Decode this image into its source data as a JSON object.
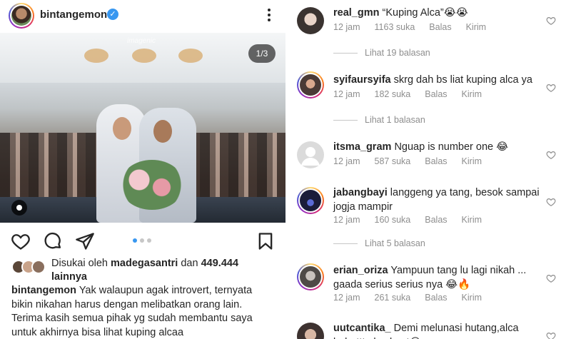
{
  "post": {
    "username": "bintangemon",
    "verified_badge": "✓",
    "watermark": "imagenic",
    "slide_counter": "1/3",
    "likes": {
      "prefix": "Disukai oleh",
      "user": "madegasantri",
      "conjunction": "dan",
      "count": "449.444",
      "suffix": "lainnya"
    },
    "caption": {
      "username": "bintangemon",
      "text": "Yak walaupun agak introvert, ternyata bikin nikahan harus dengan melibatkan orang lain. Terima kasih semua pihak yg sudah membantu saya untuk akhirnya bisa lihat kuping alcaa"
    },
    "carousel": {
      "total": 3,
      "current": 1
    }
  },
  "comments": [
    {
      "username": "real_gmn",
      "text": "“Kuping Alca”😭😭",
      "time": "12 jam",
      "likes": "1163 suka",
      "reply": "Balas",
      "send": "Kirim",
      "replies_label": "Lihat 19 balasan",
      "ring": false
    },
    {
      "username": "syifaursyifa",
      "text": "skrg dah bs liat kuping alca ya",
      "time": "12 jam",
      "likes": "182 suka",
      "reply": "Balas",
      "send": "Kirim",
      "replies_label": "Lihat 1 balasan",
      "ring": true
    },
    {
      "username": "itsma_gram",
      "text": "Nguap is number one 😂",
      "time": "12 jam",
      "likes": "587 suka",
      "reply": "Balas",
      "send": "Kirim",
      "ring": false
    },
    {
      "username": "jabangbayi",
      "text": "langgeng ya tang, besok sampai jogja mampir",
      "time": "12 jam",
      "likes": "160 suka",
      "reply": "Balas",
      "send": "Kirim",
      "replies_label": "Lihat 5 balasan",
      "ring": true
    },
    {
      "username": "erian_oriza",
      "text": "Yampuun tang lu lagi nikah ... gaada serius serius nya 😂🔥",
      "time": "12 jam",
      "likes": "261 suka",
      "reply": "Balas",
      "send": "Kirim",
      "ring": true
    },
    {
      "username": "uutcantika_",
      "text": "Demi melunasi hutang,alca bebattt alca kuat😂",
      "ring": false
    }
  ],
  "icons": {
    "like": "heart-icon",
    "comment": "comment-icon",
    "share": "send-icon",
    "save": "bookmark-icon",
    "more": "more-options-icon",
    "tag": "user-tag-icon"
  },
  "colors": {
    "text": "#262626",
    "muted": "#8e8e8e",
    "accent": "#3897f0"
  }
}
